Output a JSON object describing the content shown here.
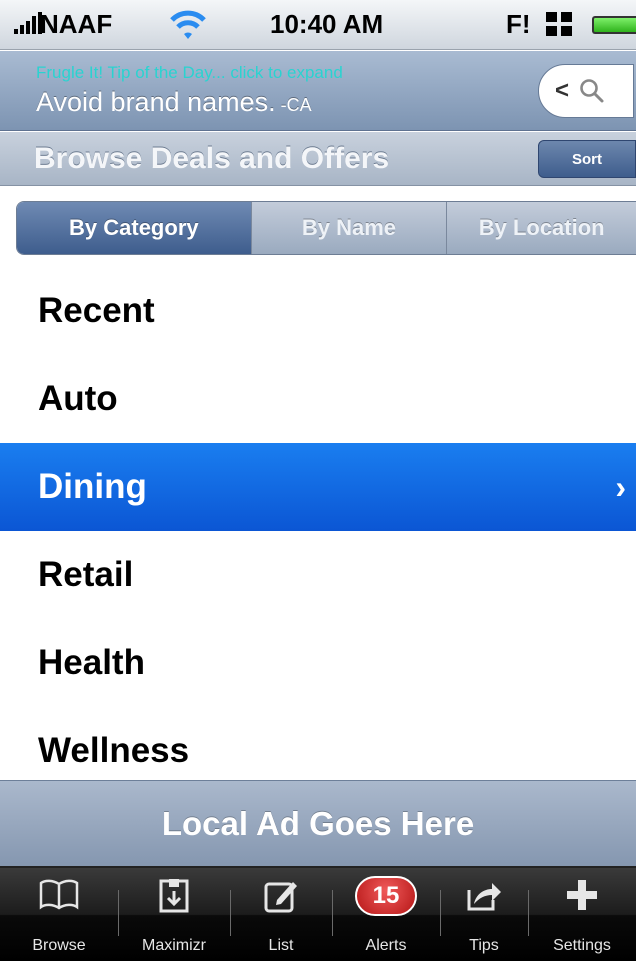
{
  "status_bar": {
    "carrier": "NAAF",
    "time": "10:40 AM",
    "indicator": "F!"
  },
  "tip": {
    "title": "Frugle It! Tip of the Day... click to expand",
    "text": "Avoid brand names.",
    "author": " -CA"
  },
  "search_button": {
    "chevron": "<"
  },
  "browse": {
    "title": "Browse Deals and Offers",
    "sort_label": "Sort"
  },
  "segments": [
    {
      "label": "By Category",
      "active": true
    },
    {
      "label": "By Name",
      "active": false
    },
    {
      "label": "By Location",
      "active": false
    }
  ],
  "categories": [
    {
      "label": "Recent"
    },
    {
      "label": "Auto"
    },
    {
      "label": "Dining",
      "selected": true
    },
    {
      "label": "Retail"
    },
    {
      "label": "Health"
    },
    {
      "label": "Wellness"
    }
  ],
  "ad": {
    "text": "Local Ad Goes Here"
  },
  "tabs": [
    {
      "label": "Browse",
      "icon": "book-icon"
    },
    {
      "label": "Maximizr",
      "icon": "maximizr-icon"
    },
    {
      "label": "List",
      "icon": "compose-icon"
    },
    {
      "label": "Alerts",
      "icon": "alerts-badge",
      "badge": "15"
    },
    {
      "label": "Tips",
      "icon": "share-icon"
    },
    {
      "label": "Settings",
      "icon": "plus-icon"
    }
  ],
  "colors": {
    "selected_row": "#0b56d4",
    "badge": "#d42a2a",
    "tip_title": "#2ad3d0"
  }
}
